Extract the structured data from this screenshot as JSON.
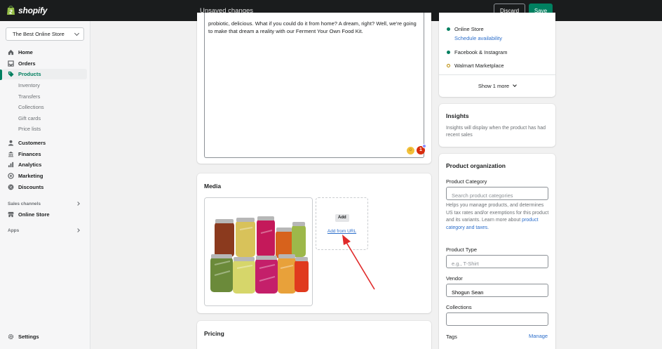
{
  "topbar": {
    "logo_text": "shopify",
    "status": "Unsaved changes",
    "discard_label": "Discard",
    "save_label": "Save"
  },
  "sidebar": {
    "store_name": "The Best Online Store",
    "items": [
      {
        "label": "Home",
        "icon": "home-icon"
      },
      {
        "label": "Orders",
        "icon": "orders-icon"
      },
      {
        "label": "Products",
        "icon": "tag-icon"
      },
      {
        "label": "Inventory"
      },
      {
        "label": "Transfers"
      },
      {
        "label": "Collections"
      },
      {
        "label": "Gift cards"
      },
      {
        "label": "Price lists"
      },
      {
        "label": "Customers",
        "icon": "person-icon"
      },
      {
        "label": "Finances",
        "icon": "bank-icon"
      },
      {
        "label": "Analytics",
        "icon": "chart-icon"
      },
      {
        "label": "Marketing",
        "icon": "target-icon"
      },
      {
        "label": "Discounts",
        "icon": "discount-icon"
      }
    ],
    "sales_channels_label": "Sales channels",
    "online_store_label": "Online Store",
    "apps_label": "Apps",
    "settings_label": "Settings"
  },
  "description": {
    "text": "probiotic, delicious. What if you could do it from home? A dream, right? Well, we're going to make that dream a reality with our Ferment Your Own Food Kit."
  },
  "media": {
    "title": "Media",
    "add_label": "Add",
    "add_url_label": "Add from URL"
  },
  "pricing": {
    "title": "Pricing"
  },
  "sales_channels": {
    "channels": [
      {
        "name": "Online Store",
        "active": true
      },
      {
        "name": "Facebook & Instagram",
        "active": true
      },
      {
        "name": "Walmart Marketplace",
        "active": false
      }
    ],
    "schedule_label": "Schedule availability",
    "show_more_label": "Show 1 more"
  },
  "insights": {
    "title": "Insights",
    "text": "Insights will display when the product has had recent sales"
  },
  "organization": {
    "title": "Product organization",
    "category_label": "Product Category",
    "category_placeholder": "Search product categories",
    "help_text": "Helps you manage products, and determines US tax rates and/or exemptions for this product and its variants. Learn more about ",
    "help_link": "product category and taxes.",
    "type_label": "Product Type",
    "type_placeholder": "e.g., T-Shirt",
    "vendor_label": "Vendor",
    "vendor_value": "Shogun Sean",
    "collections_label": "Collections",
    "tags_label": "Tags",
    "manage_label": "Manage"
  },
  "colors": {
    "topbar": "#1a1c1d",
    "primary": "#008060",
    "link": "#2c6ecb",
    "annotation_arrow": "#e02a2a"
  }
}
